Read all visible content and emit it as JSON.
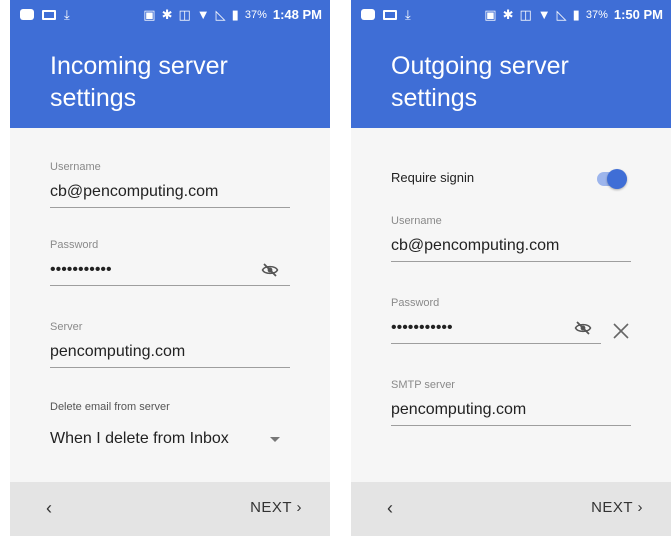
{
  "left": {
    "status": {
      "battery": "37%",
      "time": "1:48 PM"
    },
    "title": "Incoming server\nsettings",
    "username": {
      "label": "Username",
      "value": "cb@pencomputing.com"
    },
    "password": {
      "label": "Password",
      "value": "•••••••••••"
    },
    "server": {
      "label": "Server",
      "value": "pencomputing.com"
    },
    "delete": {
      "label": "Delete email from server",
      "value": "When I delete from Inbox"
    },
    "footer": {
      "back": "‹",
      "next": "NEXT ›"
    }
  },
  "right": {
    "status": {
      "battery": "37%",
      "time": "1:50 PM"
    },
    "title": "Outgoing server\nsettings",
    "require_signin": {
      "label": "Require signin",
      "on": true
    },
    "username": {
      "label": "Username",
      "value": "cb@pencomputing.com"
    },
    "password": {
      "label": "Password",
      "value": "•••••••••••"
    },
    "smtp": {
      "label": "SMTP server",
      "value": "pencomputing.com"
    },
    "footer": {
      "back": "‹",
      "next": "NEXT ›"
    }
  },
  "colors": {
    "accent": "#3f6ed6",
    "background": "#f6f6f6",
    "footer": "#e4e4e4"
  },
  "icons": [
    "message-icon",
    "mail-icon",
    "download-icon",
    "nfc-icon",
    "bluetooth-icon",
    "vibrate-icon",
    "wifi-icon",
    "no-signal-icon",
    "battery-icon",
    "visibility-off-icon",
    "clear-icon",
    "dropdown-caret-icon"
  ]
}
